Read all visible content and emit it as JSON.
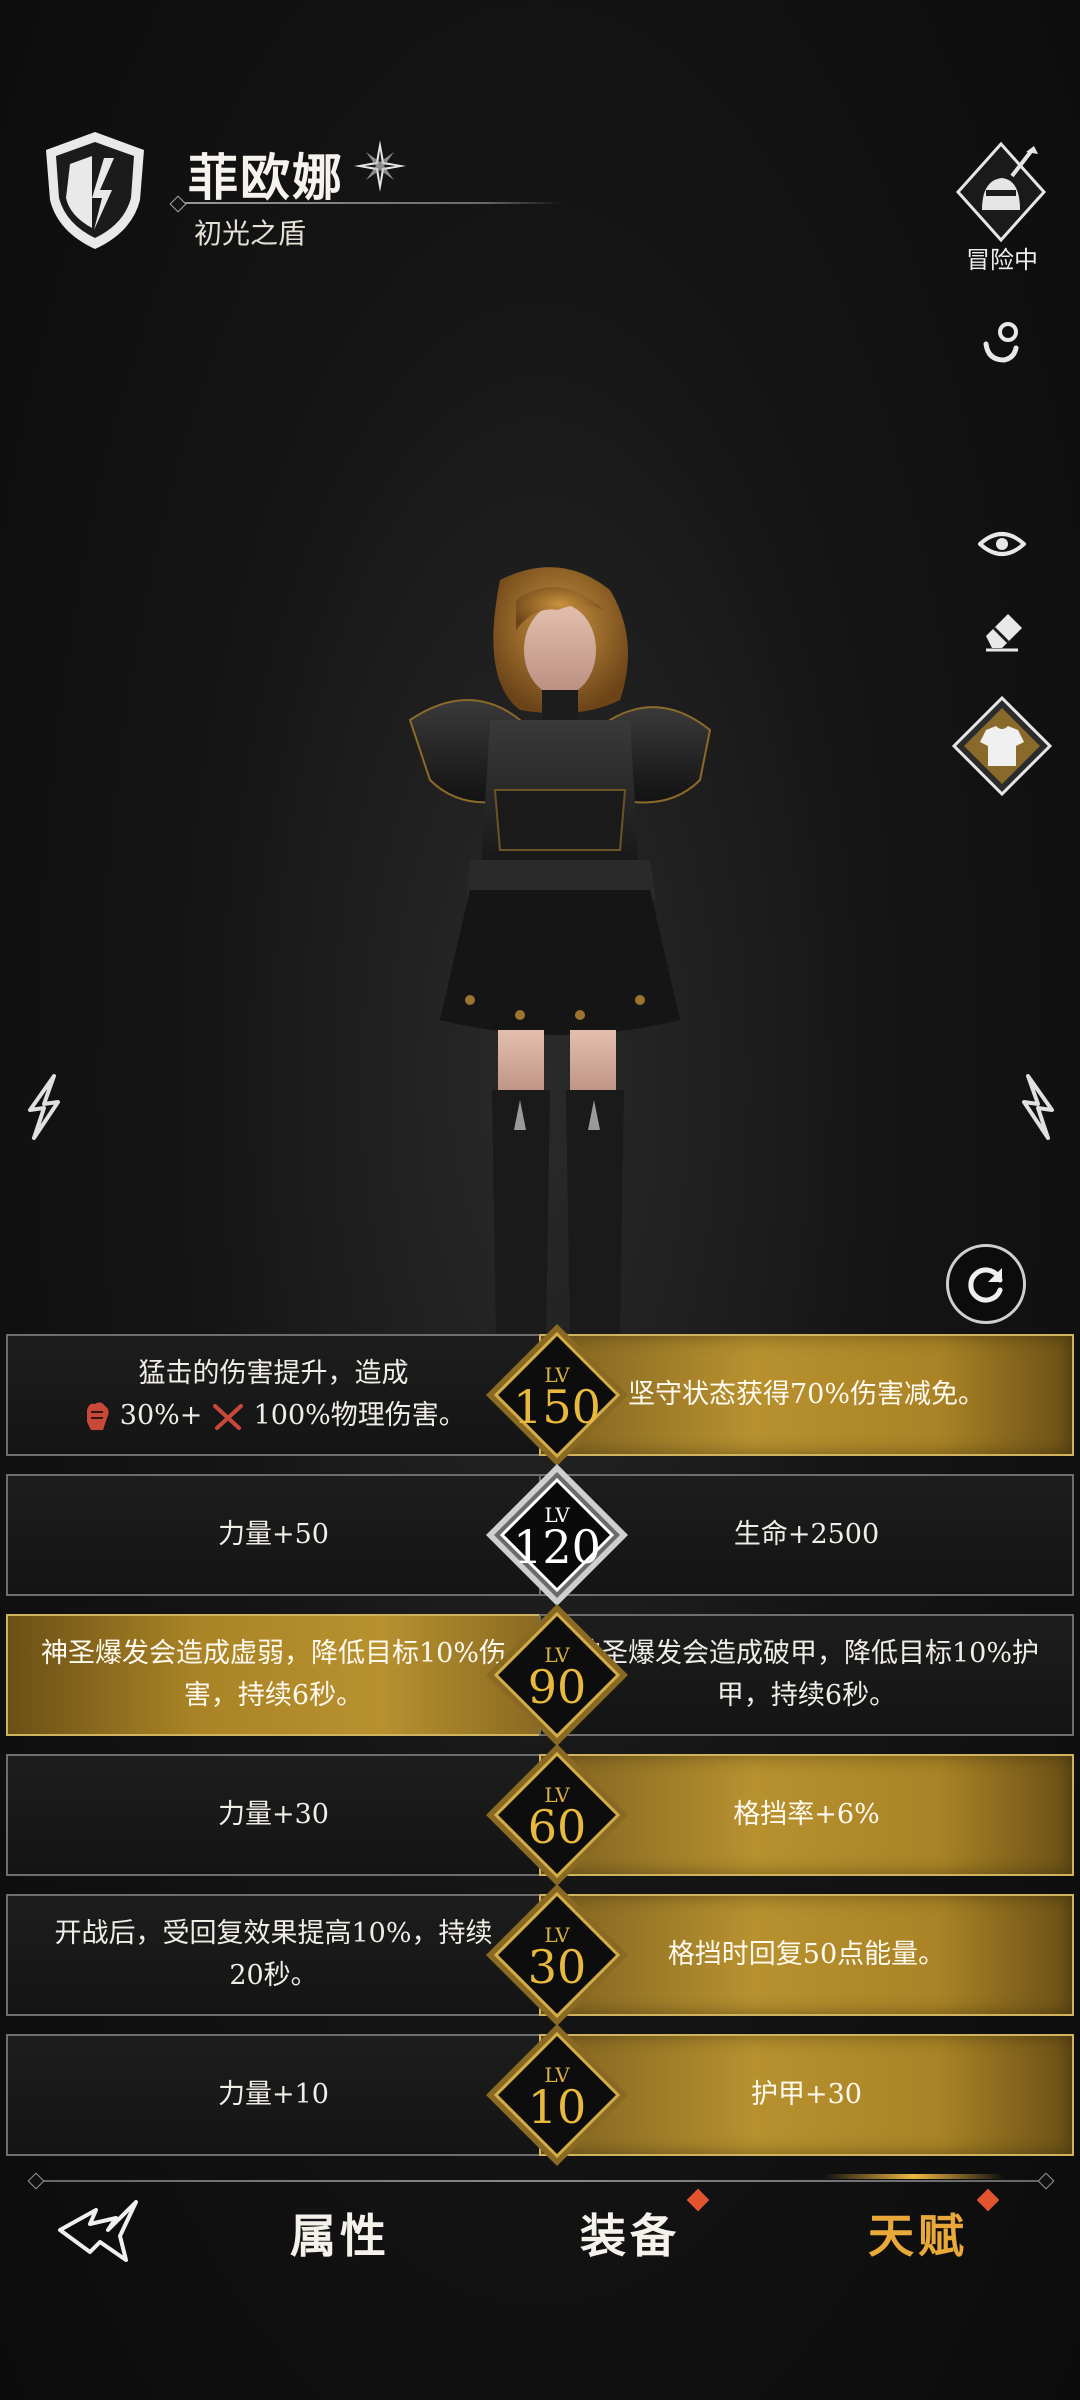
{
  "header": {
    "character_name": "菲欧娜",
    "character_title": "初光之盾",
    "class_icon": "shield-lightning-icon",
    "rank_icon": "compass-star-icon"
  },
  "sidebar": {
    "status_label": "冒险中",
    "status_icon": "knight-helmet-sword-icon",
    "icons": [
      "gesture-hand-icon",
      "eye-icon",
      "eraser-icon",
      "shirt-icon"
    ]
  },
  "talents": [
    {
      "level_prefix": "LV",
      "level": "150",
      "left_line1": "猛击的伤害提升，造成",
      "left_line2_a": "30%+",
      "left_line2_b": "100%物理伤害。",
      "right": "坚守状态获得70%伤害减免。",
      "selected": "right"
    },
    {
      "level_prefix": "LV",
      "level": "120",
      "left": "力量+50",
      "right": "生命+2500",
      "selected": "none"
    },
    {
      "level_prefix": "LV",
      "level": "90",
      "left": "神圣爆发会造成虚弱，降低目标10%伤害，持续6秒。",
      "right": "神圣爆发会造成破甲，降低目标10%护甲，持续6秒。",
      "selected": "left"
    },
    {
      "level_prefix": "LV",
      "level": "60",
      "left": "力量+30",
      "right": "格挡率+6%",
      "selected": "right"
    },
    {
      "level_prefix": "LV",
      "level": "30",
      "left": "开战后，受回复效果提高10%，持续20秒。",
      "right": "格挡时回复50点能量。",
      "selected": "right"
    },
    {
      "level_prefix": "LV",
      "level": "10",
      "left": "力量+10",
      "right": "护甲+30",
      "selected": "right"
    }
  ],
  "tabs": {
    "attributes": "属性",
    "equipment": "装备",
    "talent": "天赋",
    "active": "talent"
  },
  "colors": {
    "gold": "#b8912f",
    "level_gold": "#e8b93c",
    "alert_dot": "#e2532f"
  }
}
